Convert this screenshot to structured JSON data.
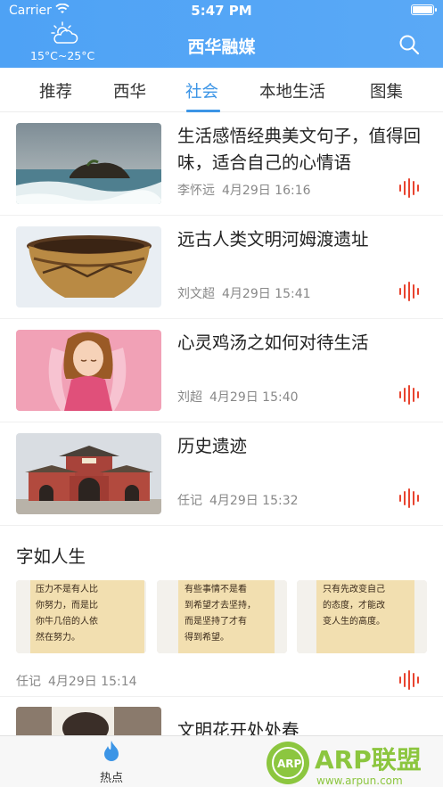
{
  "status_bar": {
    "carrier": "Carrier",
    "time": "5:47 PM",
    "battery_level": 1.0
  },
  "header": {
    "weather_icon": "partly-cloudy-icon",
    "temperature": "15°C~25°C",
    "title": "西华融媒",
    "search_icon": "search-icon"
  },
  "tabs": [
    {
      "label": "推荐",
      "active": false
    },
    {
      "label": "西华",
      "active": false
    },
    {
      "label": "社会",
      "active": true
    },
    {
      "label": "本地生活",
      "active": false
    },
    {
      "label": "图集",
      "active": false
    }
  ],
  "news": [
    {
      "title": "生活感悟经典美文句子，值得回味，适合自己的心情语",
      "author": "李怀远",
      "date": "4月29日 16:16",
      "thumb": "seaside-rock-image"
    },
    {
      "title": "远古人类文明河姆渡遗址",
      "author": "刘文超",
      "date": "4月29日 15:41",
      "thumb": "ancient-pottery-image"
    },
    {
      "title": "心灵鸡汤之如何对待生活",
      "author": "刘超",
      "date": "4月29日 15:40",
      "thumb": "meditation-girl-image"
    },
    {
      "title": "历史遗迹",
      "author": "任记",
      "date": "4月29日 15:32",
      "thumb": "temple-gate-image"
    }
  ],
  "gallery_section": {
    "title": "字如人生",
    "images": [
      {
        "lines": [
          "压力不是有人比",
          "你努力，而是比",
          "你牛几倍的人依",
          "然在努力。"
        ]
      },
      {
        "lines": [
          "有些事情不是看",
          "到希望才去坚持，",
          "而是坚持了才有",
          "得到希望。"
        ]
      },
      {
        "lines": [
          "只有先改变自己",
          "的态度，才能改",
          "变人生的高度。"
        ]
      }
    ],
    "author": "任记",
    "date": "4月29日 15:14"
  },
  "partial_news": {
    "title": "文明花开处处春"
  },
  "bottom_nav": {
    "hot_label": "热点",
    "hot_icon": "flame-icon"
  },
  "watermark": {
    "logo_text": "ARP联盟",
    "url": "www.arpun.com"
  },
  "colors": {
    "header": "#4ea2f5",
    "accent": "#3c95e6",
    "audio": "#e8442f"
  }
}
